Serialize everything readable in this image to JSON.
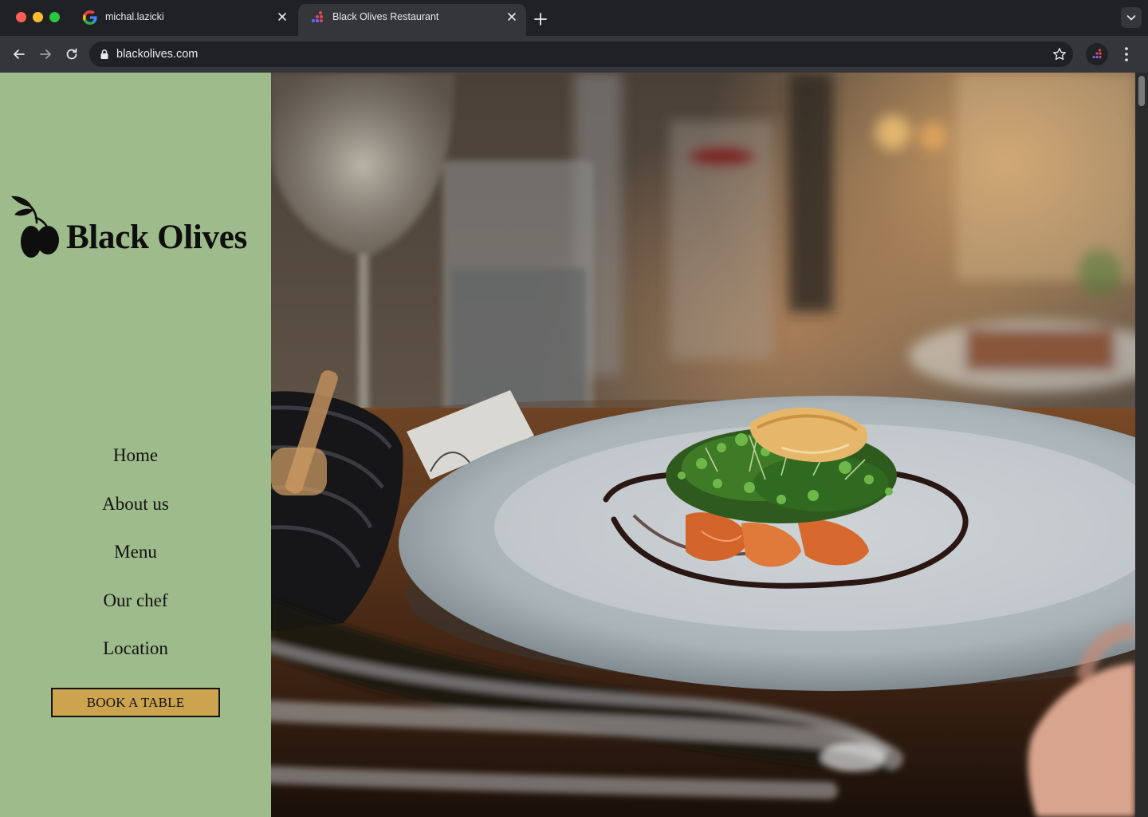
{
  "browser": {
    "tabs": [
      {
        "title": "michal.lazicki",
        "favicon": "google-icon",
        "active": false
      },
      {
        "title": "Black Olives Restaurant",
        "favicon": "dots-favicon-icon",
        "active": true
      }
    ],
    "url": "blackolives.com"
  },
  "site": {
    "brand": "Black Olives",
    "nav": [
      "Home",
      "About us",
      "Menu",
      "Our chef",
      "Location"
    ],
    "cta": "BOOK A TABLE",
    "hero_image": "plated dish with microgreens on white plate in restaurant setting",
    "colors": {
      "sidebar_bg": "#9ebb8c",
      "cta_bg": "#cca450",
      "text": "#121212"
    }
  }
}
